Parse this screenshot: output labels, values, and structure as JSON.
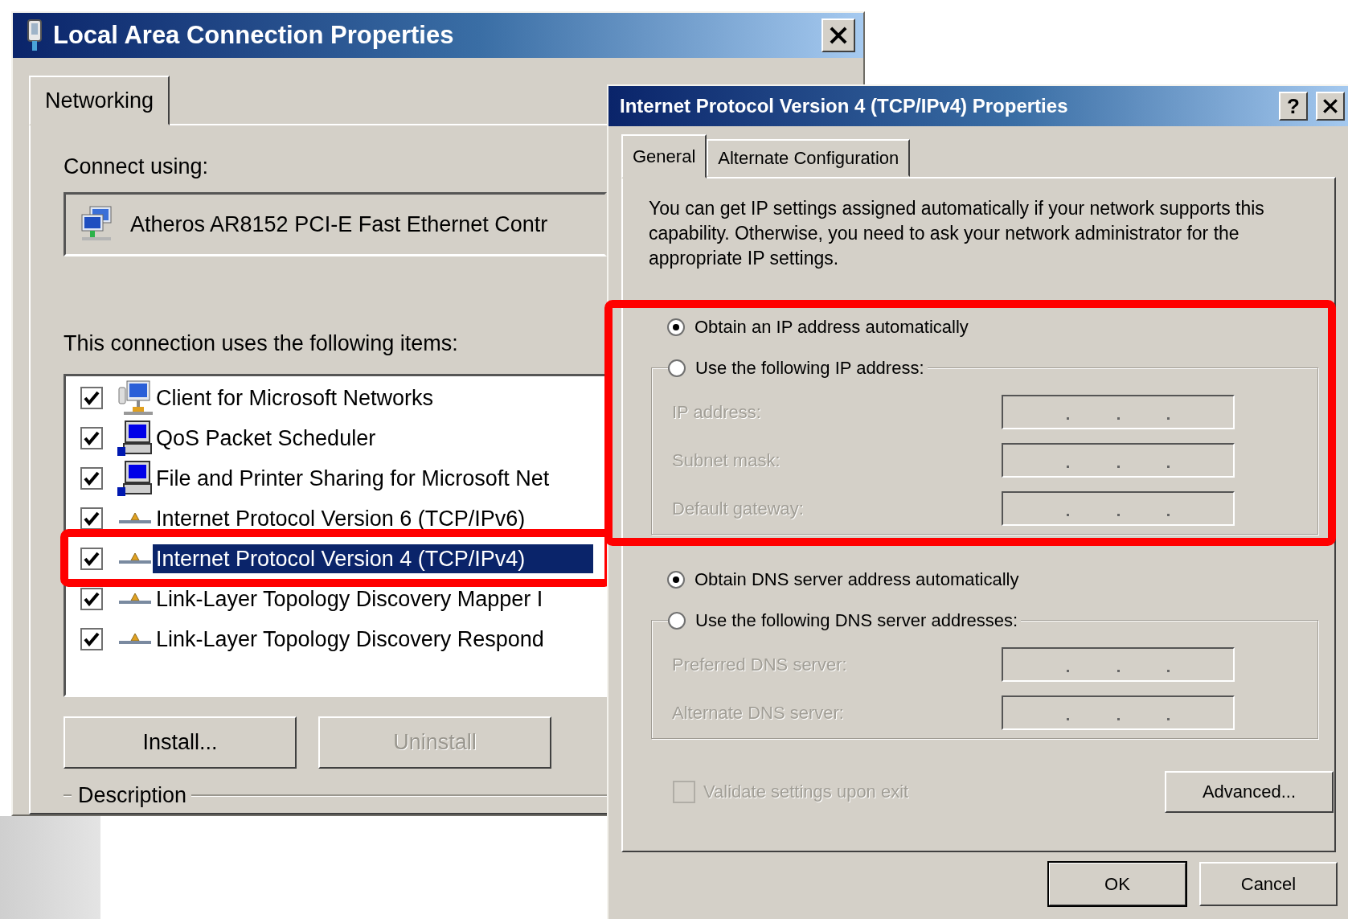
{
  "connection_dialog": {
    "title": "Local Area Connection Properties",
    "tabs": [
      {
        "label": "Networking",
        "selected": true
      }
    ],
    "connect_label": "Connect using:",
    "adapter": "Atheros AR8152 PCI-E Fast Ethernet Contr",
    "items_label": "This connection uses the following items:",
    "items": [
      {
        "kind": "client",
        "label": "Client for Microsoft Networks",
        "checked": true,
        "selected": false,
        "highlighted": false
      },
      {
        "kind": "service",
        "label": "QoS Packet Scheduler",
        "checked": true,
        "selected": false,
        "highlighted": false
      },
      {
        "kind": "service",
        "label": "File and Printer Sharing for Microsoft Net",
        "checked": true,
        "selected": false,
        "highlighted": false
      },
      {
        "kind": "protocol",
        "label": "Internet Protocol Version 6 (TCP/IPv6)",
        "checked": true,
        "selected": false,
        "highlighted": false
      },
      {
        "kind": "protocol",
        "label": "Internet Protocol Version 4 (TCP/IPv4)",
        "checked": true,
        "selected": true,
        "highlighted": true
      },
      {
        "kind": "protocol",
        "label": "Link-Layer Topology Discovery Mapper I",
        "checked": true,
        "selected": false,
        "highlighted": false
      },
      {
        "kind": "protocol",
        "label": "Link-Layer Topology Discovery Respond",
        "checked": true,
        "selected": false,
        "highlighted": false
      }
    ],
    "buttons": [
      {
        "label": "Install...",
        "disabled": false
      },
      {
        "label": "Uninstall",
        "disabled": true
      }
    ],
    "description_label": "Description"
  },
  "ipv4_dialog": {
    "title": "Internet Protocol Version 4 (TCP/IPv4) Properties",
    "help_button": "?",
    "tabs": [
      {
        "label": "General",
        "selected": true
      },
      {
        "label": "Alternate Configuration",
        "selected": false
      }
    ],
    "intro": "You can get IP settings assigned automatically if your network supports this capability. Otherwise, you need to ask your network administrator for the appropriate IP settings.",
    "ip_highlighted": true,
    "ip_auto": {
      "label": "Obtain an IP address automatically",
      "selected": true
    },
    "ip_manual": {
      "label": "Use the following IP address:",
      "selected": false
    },
    "ip_fields": [
      {
        "label": "IP address:",
        "disabled": true
      },
      {
        "label": "Subnet mask:",
        "disabled": true
      },
      {
        "label": "Default gateway:",
        "disabled": true
      }
    ],
    "dns_auto": {
      "label": "Obtain DNS server address automatically",
      "selected": true
    },
    "dns_manual": {
      "label": "Use the following DNS server addresses:",
      "selected": false
    },
    "dns_fields": [
      {
        "label": "Preferred DNS server:",
        "disabled": true
      },
      {
        "label": "Alternate DNS server:",
        "disabled": true
      }
    ],
    "validate": {
      "label": "Validate settings upon exit",
      "checked": false,
      "disabled": true
    },
    "advanced_button": "Advanced...",
    "buttons": [
      {
        "label": "OK",
        "default": true
      },
      {
        "label": "Cancel",
        "default": false
      }
    ]
  }
}
